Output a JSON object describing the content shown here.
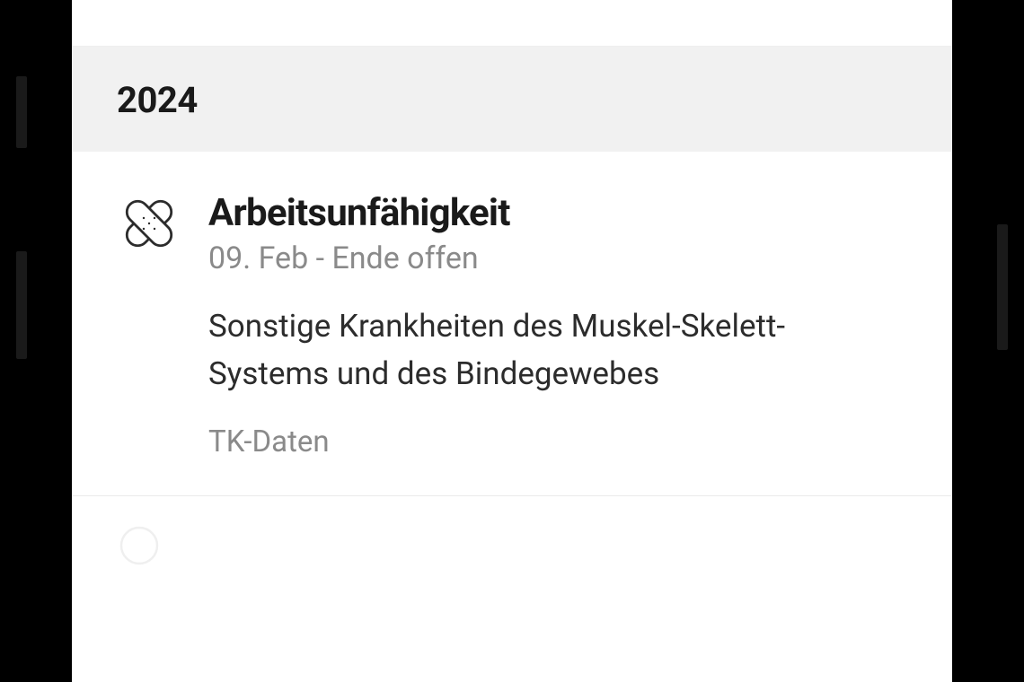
{
  "year": "2024",
  "entry": {
    "title": "Arbeitsunfähigkeit",
    "dates": "09. Feb - Ende offen",
    "description": "Sonstige Krankheiten des Muskel-Skelett-Systems und des Bindegewebes",
    "source": "TK-Daten"
  }
}
